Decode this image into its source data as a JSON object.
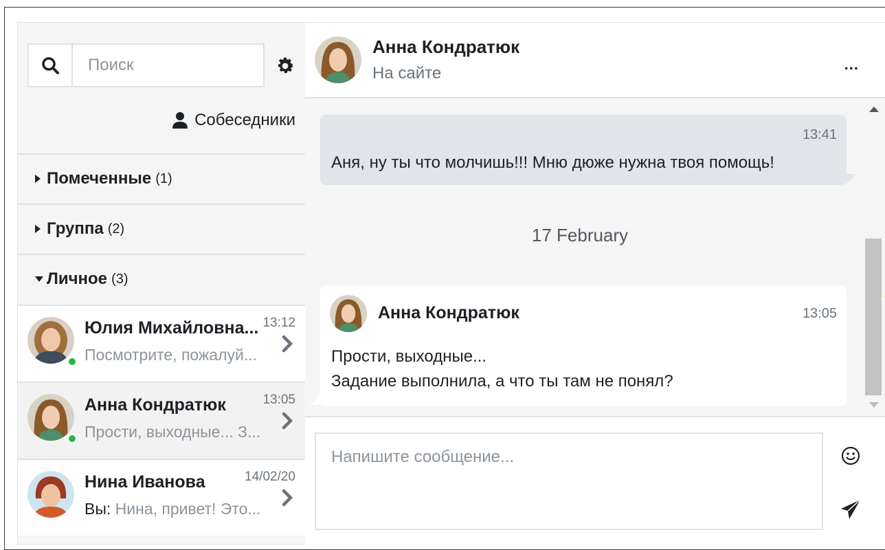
{
  "sidebar": {
    "search_placeholder": "Поиск",
    "contacts_label": "Собеседники",
    "sections": [
      {
        "name": "Помеченные",
        "count": "(1)",
        "expanded": false
      },
      {
        "name": "Группа",
        "count": "(2)",
        "expanded": false
      },
      {
        "name": "Личное",
        "count": "(3)",
        "expanded": true
      }
    ],
    "conversations": [
      {
        "name": "Юлия Михайловна...",
        "time": "13:12",
        "message": "Посмотрите, пожалуй...",
        "online": true
      },
      {
        "name": "Анна Кондратюк",
        "time": "13:05",
        "message": "Прости, выходные... З...",
        "online": true
      },
      {
        "name": "Нина Иванова",
        "time": "14/02/20",
        "prefix": "Вы:",
        "message": "Нина, привет! Это...",
        "online": false
      }
    ]
  },
  "header": {
    "name": "Анна Кондратюк",
    "status": "На сайте",
    "more": "..."
  },
  "messages": {
    "outgoing": {
      "time": "13:41",
      "text": "Аня, ну ты что молчишь!!! Мню дюже нужна твоя помощь!"
    },
    "day_divider": "17 February",
    "incoming": {
      "name": "Анна Кондратюк",
      "time": "13:05",
      "line1": "Прости, выходные...",
      "line2": "Задание выполнила, а что ты там не понял?"
    }
  },
  "compose": {
    "placeholder": "Напишите сообщение..."
  },
  "colors": {
    "online": "#2bb34b",
    "bubble_out": "#e1e4e8",
    "scroll_pointer": "#f0b400"
  }
}
